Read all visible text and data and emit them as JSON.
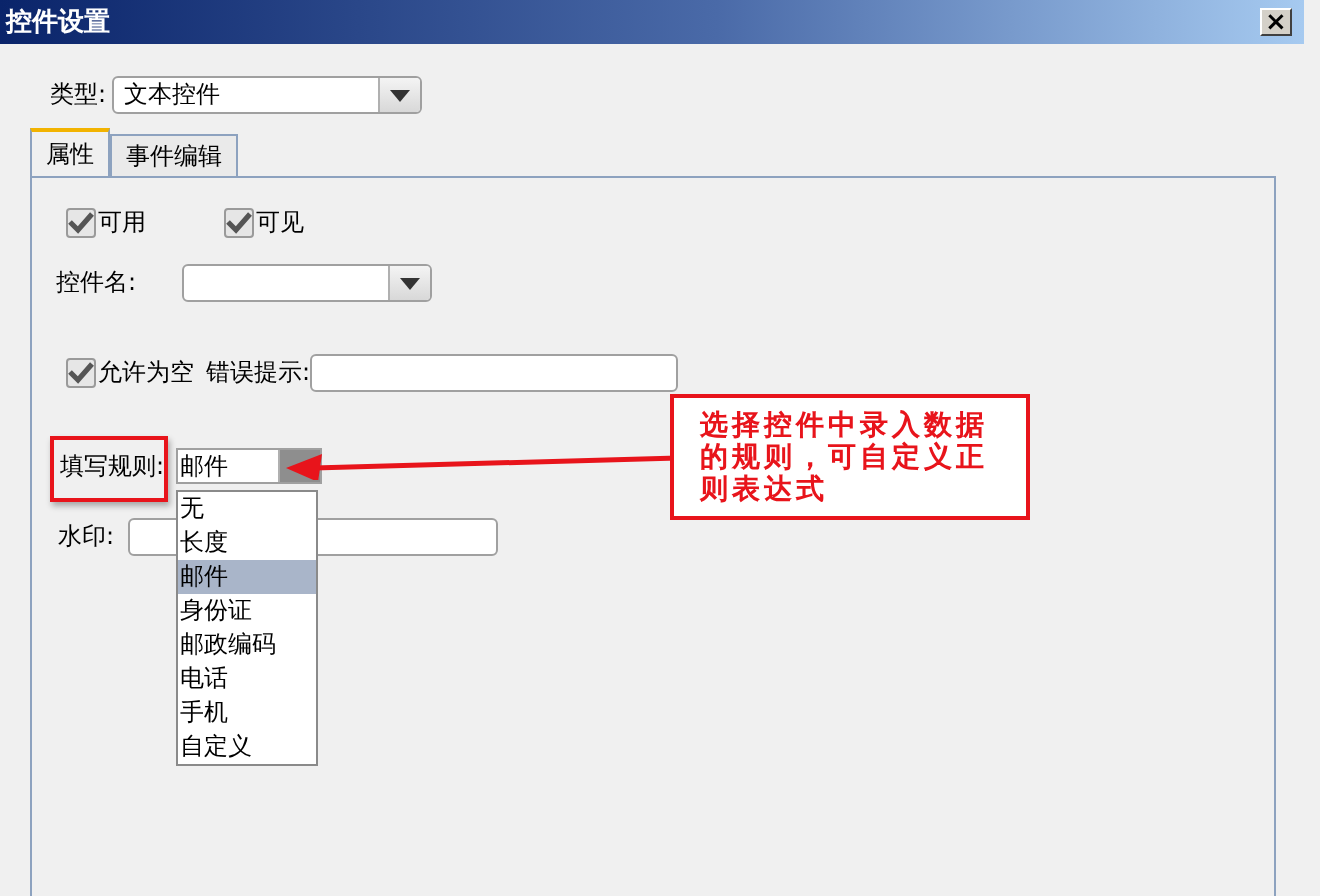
{
  "window": {
    "title": "控件设置",
    "close": "×"
  },
  "type_field": {
    "label": "类型:",
    "value": "文本控件"
  },
  "tabs": [
    {
      "label": "属性",
      "selected": true
    },
    {
      "label": "事件编辑",
      "selected": false
    }
  ],
  "properties": {
    "checkboxes": [
      {
        "label": "可用",
        "checked": true
      },
      {
        "label": "可见",
        "checked": true
      }
    ],
    "control_name": {
      "label": "控件名:"
    },
    "allow_empty": {
      "label": "允许为空",
      "checked": true
    },
    "error_hint": {
      "label": "错误提示:"
    },
    "fill_rule": {
      "label": "填写规则:",
      "value": "邮件",
      "options": [
        {
          "label": "无",
          "selected": false
        },
        {
          "label": "长度",
          "selected": false
        },
        {
          "label": "邮件",
          "selected": true
        },
        {
          "label": "身份证",
          "selected": false
        },
        {
          "label": "邮政编码",
          "selected": false
        },
        {
          "label": "电话",
          "selected": false
        },
        {
          "label": "手机",
          "selected": false
        },
        {
          "label": "自定义",
          "selected": false
        }
      ]
    },
    "watermark": {
      "label": "水印:"
    }
  },
  "callout": {
    "text": "选择控件中录入数据的规则，可自定义正则表达式"
  }
}
